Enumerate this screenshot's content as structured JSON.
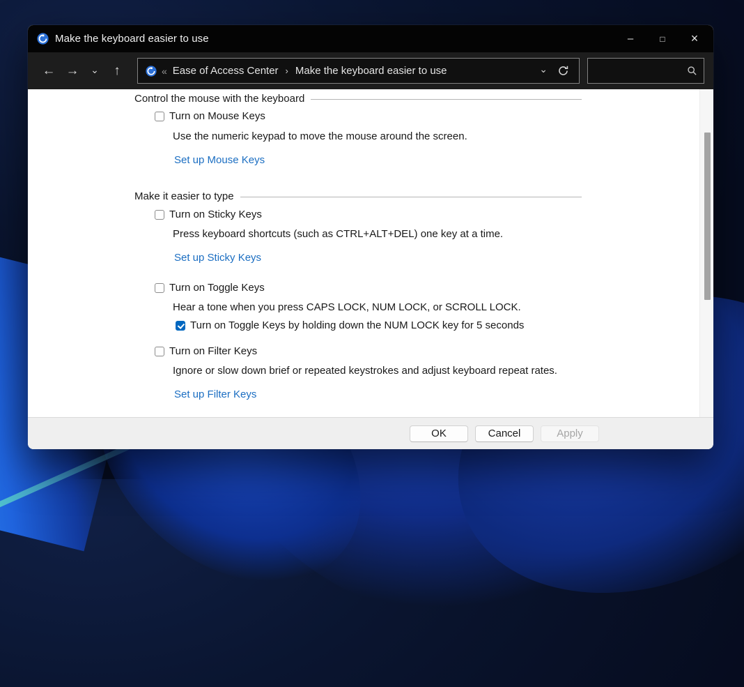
{
  "window": {
    "title": "Make the keyboard easier to use",
    "controls": {
      "minimize": "–",
      "maximize": "□",
      "close": "×"
    }
  },
  "navbar": {
    "icons": {
      "back": "←",
      "forward": "→",
      "recent": "⌄",
      "up": "↑",
      "dropdown": "⌄"
    },
    "breadcrumb": {
      "chevrons": "«",
      "root": "Ease of Access Center",
      "separator": "›",
      "current": "Make the keyboard easier to use"
    },
    "search": {
      "value": ""
    }
  },
  "content": {
    "sections": [
      {
        "header": "Control the mouse with the keyboard",
        "groups": [
          {
            "checkbox": {
              "label": "Turn on Mouse Keys",
              "checked": false
            },
            "description": "Use the numeric keypad to move the mouse around the screen.",
            "link": "Set up Mouse Keys"
          }
        ]
      },
      {
        "header": "Make it easier to type",
        "groups": [
          {
            "checkbox": {
              "label": "Turn on Sticky Keys",
              "checked": false
            },
            "description": "Press keyboard shortcuts (such as CTRL+ALT+DEL) one key at a time.",
            "link": "Set up Sticky Keys"
          },
          {
            "checkbox": {
              "label": "Turn on Toggle Keys",
              "checked": false
            },
            "description": "Hear a tone when you press CAPS LOCK, NUM LOCK, or SCROLL LOCK.",
            "sub_checkbox": {
              "label": "Turn on Toggle Keys by holding down the NUM LOCK key for 5 seconds",
              "checked": true
            }
          },
          {
            "checkbox": {
              "label": "Turn on Filter Keys",
              "checked": false
            },
            "description": "Ignore or slow down brief or repeated keystrokes and adjust keyboard repeat rates.",
            "link": "Set up Filter Keys"
          }
        ]
      }
    ]
  },
  "footer": {
    "buttons": [
      {
        "label": "OK",
        "enabled": true
      },
      {
        "label": "Cancel",
        "enabled": true
      },
      {
        "label": "Apply",
        "enabled": false
      }
    ]
  },
  "colors": {
    "accent": "#0067c0",
    "link": "#1b6ec2",
    "titlebar_bg": "#040404",
    "navbar_bg": "#1d1d1d",
    "footer_bg": "#efefef"
  }
}
